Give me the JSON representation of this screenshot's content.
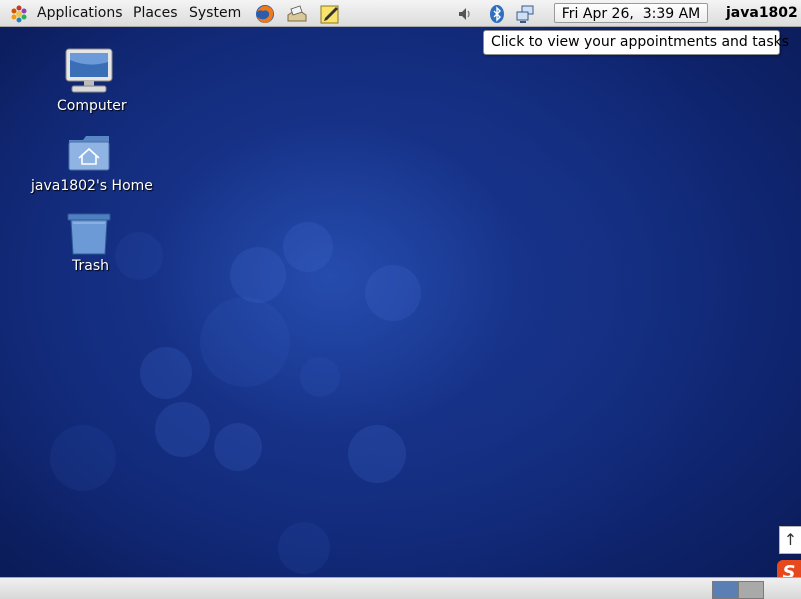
{
  "top_panel": {
    "menus": [
      "Applications",
      "Places",
      "System"
    ],
    "clock_text": "Fri Apr 26,  3:39 AM",
    "username": "java1802",
    "launchers": [
      "firefox-icon",
      "mail-icon",
      "text-editor-icon"
    ],
    "tray": [
      "volume-icon",
      "bluetooth-icon",
      "network-icon"
    ]
  },
  "tooltip": {
    "text": "Click to view your appointments and tasks"
  },
  "desktop": {
    "icons": [
      {
        "label": "Computer",
        "icon": "computer-icon"
      },
      {
        "label": "java1802's Home",
        "icon": "home-folder-icon"
      },
      {
        "label": "Trash",
        "icon": "trash-icon"
      }
    ]
  },
  "bottom_panel": {
    "workspaces": 2,
    "active_workspace": 1
  },
  "side_widget": {
    "arrow": "↑",
    "sogou": "S"
  },
  "colors": {
    "desktop_bg": "#15307e",
    "panel_bg": "#e6e6e6",
    "workspace_active": "#5b7fb5",
    "workspace_inactive": "#a9a9a9"
  }
}
